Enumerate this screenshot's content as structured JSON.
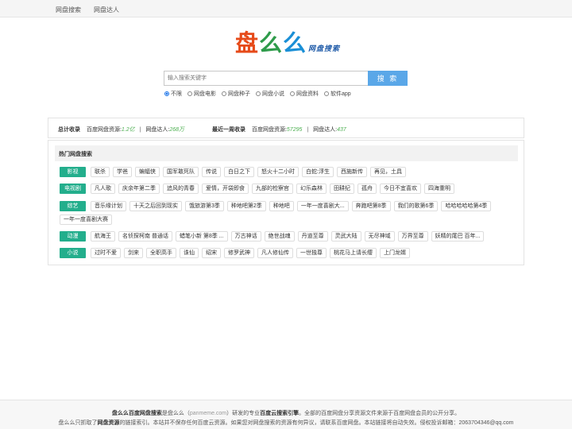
{
  "nav": {
    "items": [
      "网盘搜索",
      "网盘达人"
    ]
  },
  "logo": {
    "chars": [
      "盘",
      "么",
      "么"
    ],
    "subtitle": "网盘搜索",
    "colors": [
      "#e64a19",
      "#2e9b4a",
      "#1a8fd6"
    ]
  },
  "search": {
    "placeholder": "输入搜索关键字",
    "button": "搜 索"
  },
  "filters": [
    {
      "label": "不限",
      "checked": true
    },
    {
      "label": "网盘电影",
      "checked": false
    },
    {
      "label": "网盘种子",
      "checked": false
    },
    {
      "label": "网盘小说",
      "checked": false
    },
    {
      "label": "网盘资料",
      "checked": false
    },
    {
      "label": "软件app",
      "checked": false
    }
  ],
  "stats": {
    "total_label": "总计收录",
    "total_res_label": "百度网盘资源:",
    "total_res": "1.2亿",
    "total_users_label": "网盘达人:",
    "total_users": "268万",
    "week_label": "最近一周收录",
    "week_res_label": "百度网盘资源:",
    "week_res": "57295",
    "week_users_label": "网盘达人:",
    "week_users": "437",
    "sep": "|"
  },
  "hot": {
    "title": "热门网盘搜索",
    "rows": [
      {
        "cat": "影视",
        "tags": [
          "联杀",
          "学爸",
          "蝙蝠侠",
          "国军敢死队",
          "传说",
          "白日之下",
          "怒火十二小时",
          "白蛇:浮生",
          "西施新传",
          "再见，土具"
        ]
      },
      {
        "cat": "电视剧",
        "tags": [
          "凡人歌",
          "庆余年第二季",
          "追风的青春",
          "爱情，开袋即食",
          "九部的检察官",
          "幻乐森林",
          "田耕纪",
          "孤舟",
          "今日不宜喜欢",
          "四海重明"
        ]
      },
      {
        "cat": "综艺",
        "tags": [
          "音乐缘计划",
          "十天之后回到现实",
          "饿旅游第3季",
          "种地吧第2季",
          "种地吧",
          "一年一度喜剧大...",
          "奔跑吧第8季",
          "我们的歌第6季",
          "哈哈哈哈哈第4季",
          "一年一度喜剧大赛"
        ]
      },
      {
        "cat": "动漫",
        "tags": [
          "航海王",
          "名侦探柯南 普通话",
          "蜡笔小新 第8季 ...",
          "万古神话",
          "绝世战魂",
          "丹道至尊",
          "灵武大陆",
          "无尽神域",
          "万界至尊",
          "妖精的尾巴 百年..."
        ]
      },
      {
        "cat": "小说",
        "tags": [
          "过时不爱",
          "剑来",
          "全职高手",
          "诛仙",
          "绍宋",
          "修罗武神",
          "凡人修仙传",
          "一世独尊",
          "桃花马上请长缨",
          "上门龙婿"
        ]
      }
    ]
  },
  "footer": {
    "l1_a": "盘么么百度网盘搜索",
    "l1_b": "是盘么么（",
    "l1_c": "panmeme.com",
    "l1_d": "）研发的专业",
    "l1_e": "百度云搜索引擎",
    "l1_f": "。全部的百度网盘分享资源文件来源于百度网盘会员的公开分享。",
    "l2_a": "盘么么只抓取了",
    "l2_b": "网盘资源",
    "l2_c": "的链接索引。本站并不保存任何百度云资源。如果您对网盘搜索的资源有何异议，请联系百度网盘。本站链接将自动失效。侵权投诉邮箱：2063704346@qq.com"
  }
}
